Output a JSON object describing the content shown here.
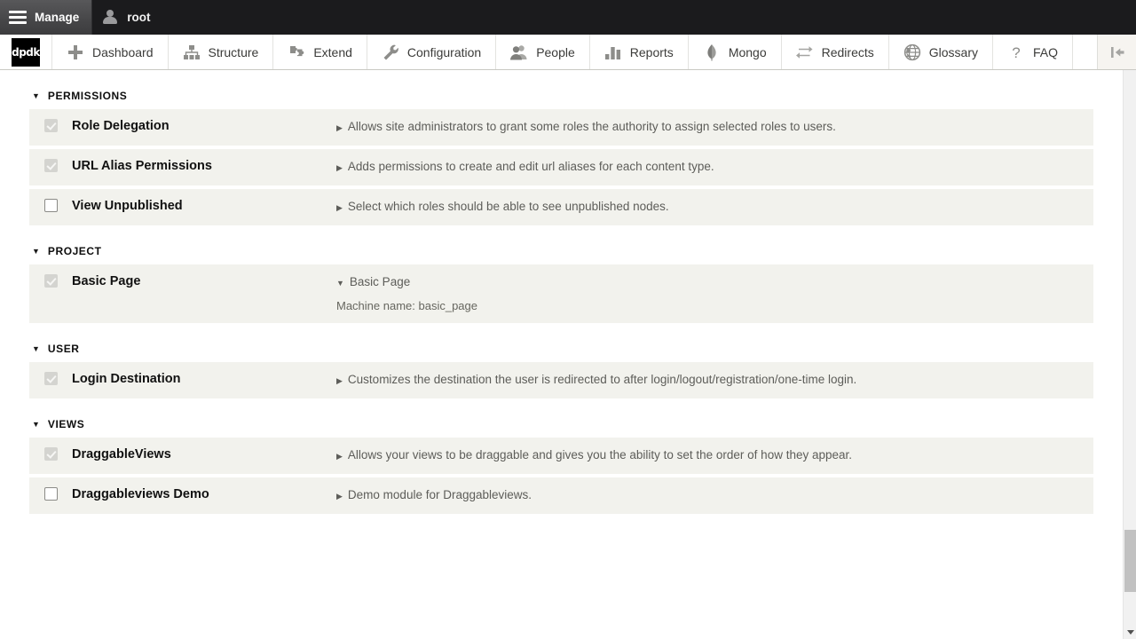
{
  "admin_bar": {
    "manage_label": "Manage",
    "manage_icon": "hamburger-icon",
    "user_label": "root",
    "user_icon": "user-icon"
  },
  "toolbar": {
    "logo_text": "dpdk",
    "collapse_icon": "collapse-left-icon",
    "items": [
      {
        "label": "Dashboard",
        "icon": "plus-icon"
      },
      {
        "label": "Structure",
        "icon": "structure-tree-icon"
      },
      {
        "label": "Extend",
        "icon": "puzzle-piece-icon"
      },
      {
        "label": "Configuration",
        "icon": "wrench-icon"
      },
      {
        "label": "People",
        "icon": "people-icon"
      },
      {
        "label": "Reports",
        "icon": "bar-chart-icon"
      },
      {
        "label": "Mongo",
        "icon": "mongo-leaf-icon"
      },
      {
        "label": "Redirects",
        "icon": "redirect-arrows-icon"
      },
      {
        "label": "Glossary",
        "icon": "globe-icon"
      },
      {
        "label": "FAQ",
        "icon": "question-mark-icon"
      }
    ]
  },
  "sections": [
    {
      "title": "PERMISSIONS",
      "caret": "▼",
      "modules": [
        {
          "name": "Role Delegation",
          "checkbox_state": "checked-disabled",
          "desc_caret": "▶",
          "description": "Allows site administrators to grant some roles the authority to assign selected roles to users.",
          "machine_name": ""
        },
        {
          "name": "URL Alias Permissions",
          "checkbox_state": "checked-disabled",
          "desc_caret": "▶",
          "description": "Adds permissions to create and edit url aliases for each content type.",
          "machine_name": ""
        },
        {
          "name": "View Unpublished",
          "checkbox_state": "unchecked",
          "desc_caret": "▶",
          "description": "Select which roles should be able to see unpublished nodes.",
          "machine_name": ""
        }
      ]
    },
    {
      "title": "PROJECT",
      "caret": "▼",
      "modules": [
        {
          "name": "Basic Page",
          "checkbox_state": "checked-disabled",
          "desc_caret": "▼",
          "description": "Basic Page",
          "machine_name": "Machine name: basic_page"
        }
      ]
    },
    {
      "title": "USER",
      "caret": "▼",
      "modules": [
        {
          "name": "Login Destination",
          "checkbox_state": "checked-disabled",
          "desc_caret": "▶",
          "description": "Customizes the destination the user is redirected to after login/logout/registration/one-time login.",
          "machine_name": ""
        }
      ]
    },
    {
      "title": "VIEWS",
      "caret": "▼",
      "modules": [
        {
          "name": "DraggableViews",
          "checkbox_state": "checked-disabled",
          "desc_caret": "▶",
          "description": "Allows your views to be draggable and gives you the ability to set the order of how they appear.",
          "machine_name": ""
        },
        {
          "name": "Draggableviews Demo",
          "checkbox_state": "unchecked",
          "desc_caret": "▶",
          "description": "Demo module for Draggableviews.",
          "machine_name": ""
        }
      ]
    }
  ],
  "scrollbar": {
    "down_arrow_icon": "chevron-down-icon"
  },
  "colors": {
    "admin_bar_bg": "#1b1b1d",
    "row_bg": "#f2f2ed",
    "scroll_thumb": "#c1c1c1",
    "text_primary": "#111111",
    "text_secondary": "#5d5d59"
  }
}
